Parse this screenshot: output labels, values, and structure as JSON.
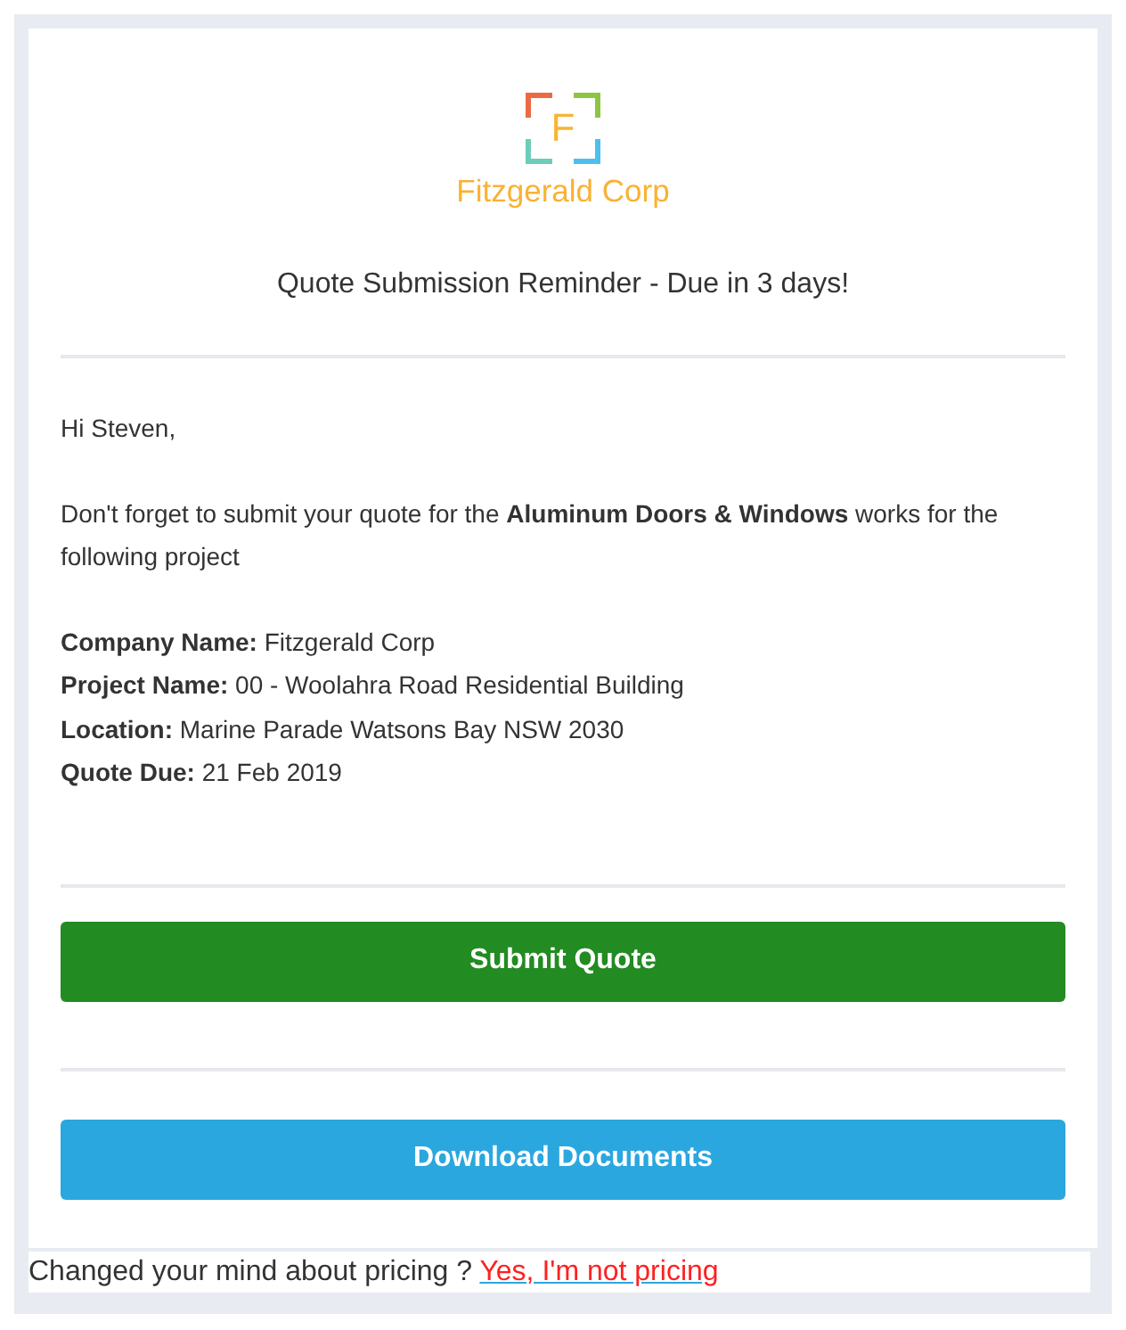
{
  "logo": {
    "letter": "F",
    "name": "Fitzgerald Corp"
  },
  "title": "Quote Submission Reminder - Due in 3 days!",
  "greeting": "Hi Steven,",
  "intro": "Don't forget to submit your quote for the **Aluminum Doors & Windows** works for the following project",
  "details": [
    {
      "label": "Company Name:",
      "value": "Fitzgerald Corp"
    },
    {
      "label": "Project Name:",
      "value": "00 - Woolahra Road Residential Building"
    },
    {
      "label": "Location:",
      "value": "Marine Parade Watsons Bay NSW 2030"
    },
    {
      "label": "Quote Due:",
      "value": "21 Feb 2019"
    }
  ],
  "buttons": [
    {
      "label": "Submit Quote",
      "kind": "primary"
    },
    {
      "label": "Download Documents",
      "kind": "secondary"
    }
  ],
  "footer": {
    "text": "Changed your mind about pricing ?",
    "link": "Yes, I'm not pricing"
  }
}
